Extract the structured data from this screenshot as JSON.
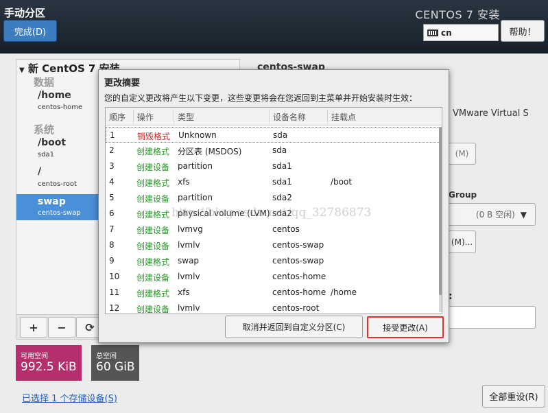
{
  "header": {
    "title": "手动分区",
    "done_label": "完成(D)",
    "install_title": "CENTOS 7 安装",
    "keyboard_layout": "cn",
    "help_label": "帮助！"
  },
  "left_pane": {
    "root_label": "新 CentOS 7 安装",
    "groups": [
      {
        "name": "数据",
        "items": [
          {
            "mount": "/home",
            "device": "centos-home"
          }
        ]
      },
      {
        "name": "系统",
        "items": [
          {
            "mount": "/boot",
            "device": "sda1"
          },
          {
            "mount": "/",
            "device": "centos-root"
          },
          {
            "mount": "swap",
            "device": "centos-swap"
          }
        ]
      }
    ],
    "toolbar": {
      "add": "+",
      "remove": "−",
      "refresh": "⟳"
    }
  },
  "space": {
    "free_label": "可用空间",
    "free_value": "992.5 KiB",
    "total_label": "总空间",
    "total_value": "60 GiB"
  },
  "storage_link": "已选择 1 个存储设备(S)",
  "reset_label": "全部重设(R)",
  "right_pane": {
    "title": "centos-swap",
    "device_desc": "VMware Virtual S",
    "btn1": "(M)",
    "group_label": "Group",
    "combo_value": "(0 B 空闲)",
    "btn2": "(M)...",
    "colon": ":"
  },
  "dialog": {
    "title": "更改摘要",
    "description": "您的自定义更改将产生以下变更，这些变更将会在您返回到主菜单并开始安装时生效：",
    "columns": [
      "顺序",
      "操作",
      "类型",
      "设备名称",
      "挂载点"
    ],
    "rows": [
      {
        "num": "1",
        "op": "销毁格式",
        "type": "Unknown",
        "device": "sda",
        "mount": ""
      },
      {
        "num": "2",
        "op": "创建格式",
        "type": "分区表 (MSDOS)",
        "device": "sda",
        "mount": ""
      },
      {
        "num": "3",
        "op": "创建设备",
        "type": "partition",
        "device": "sda1",
        "mount": ""
      },
      {
        "num": "4",
        "op": "创建格式",
        "type": "xfs",
        "device": "sda1",
        "mount": "/boot"
      },
      {
        "num": "5",
        "op": "创建设备",
        "type": "partition",
        "device": "sda2",
        "mount": ""
      },
      {
        "num": "6",
        "op": "创建格式",
        "type": "physical volume (LVM)",
        "device": "sda2",
        "mount": ""
      },
      {
        "num": "7",
        "op": "创建设备",
        "type": "lvmvg",
        "device": "centos",
        "mount": ""
      },
      {
        "num": "8",
        "op": "创建设备",
        "type": "lvmlv",
        "device": "centos-swap",
        "mount": ""
      },
      {
        "num": "9",
        "op": "创建格式",
        "type": "swap",
        "device": "centos-swap",
        "mount": ""
      },
      {
        "num": "10",
        "op": "创建设备",
        "type": "lvmlv",
        "device": "centos-home",
        "mount": ""
      },
      {
        "num": "11",
        "op": "创建格式",
        "type": "xfs",
        "device": "centos-home",
        "mount": "/home"
      },
      {
        "num": "12",
        "op": "创建设备",
        "type": "lvmlv",
        "device": "centos-root",
        "mount": ""
      }
    ],
    "cancel_label": "取消并返回到自定义分区(C)",
    "accept_label": "接受更改(A)"
  },
  "watermark": "http://blog.csdn.net/qq_32786873",
  "colors": {
    "destroy": "#d41f1f",
    "create": "#2a9a2a",
    "selected": "#4a90d9",
    "free_space": "#b52f6c",
    "accept_outline": "#e03131"
  }
}
